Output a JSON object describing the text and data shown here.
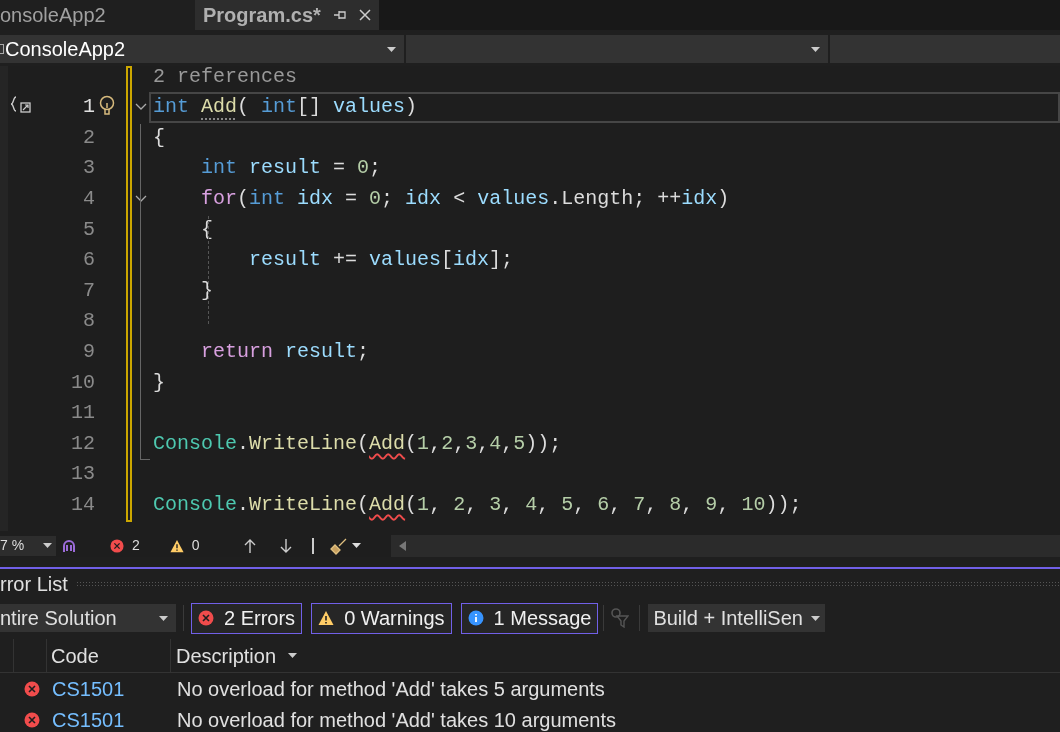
{
  "tabs": [
    {
      "label": "onsoleApp2",
      "selected": false,
      "pinned": false
    },
    {
      "label": "Program.cs*",
      "selected": true,
      "pinned": true
    }
  ],
  "nav_bar": {
    "project": "ConsoleApp2"
  },
  "editor": {
    "codelens": "2 references",
    "lines": [
      {
        "number": "1",
        "fold": true,
        "current": true,
        "tokens": [
          {
            "text": "int ",
            "color": "#569cd6",
            "kind": "plain"
          },
          {
            "text": "Add",
            "color": "#dcdcaa",
            "kind": "dotted"
          },
          {
            "text": "( ",
            "color": "#dcdcdc",
            "kind": "plain"
          },
          {
            "text": "int",
            "color": "#569cd6",
            "kind": "plain"
          },
          {
            "text": "[] ",
            "color": "#dcdcdc",
            "kind": "plain"
          },
          {
            "text": "values",
            "color": "#9cdcfe",
            "kind": "plain"
          },
          {
            "text": ")",
            "color": "#dcdcdc",
            "kind": "plain"
          }
        ]
      },
      {
        "number": "2",
        "fold": false,
        "current": false,
        "tokens": [
          {
            "text": "{",
            "color": "#dcdcdc",
            "kind": "plain"
          }
        ]
      },
      {
        "number": "3",
        "fold": false,
        "current": false,
        "tokens": [
          {
            "text": "    int ",
            "color": "#569cd6",
            "kind": "plain"
          },
          {
            "text": "result",
            "color": "#9cdcfe",
            "kind": "plain"
          },
          {
            "text": " = ",
            "color": "#dcdcdc",
            "kind": "plain"
          },
          {
            "text": "0",
            "color": "#b5cea8",
            "kind": "plain"
          },
          {
            "text": ";",
            "color": "#dcdcdc",
            "kind": "plain"
          }
        ]
      },
      {
        "number": "4",
        "fold": true,
        "current": false,
        "tokens": [
          {
            "text": "    for",
            "color": "#d8a0df",
            "kind": "plain"
          },
          {
            "text": "(",
            "color": "#dcdcdc",
            "kind": "plain"
          },
          {
            "text": "int ",
            "color": "#569cd6",
            "kind": "plain"
          },
          {
            "text": "idx",
            "color": "#9cdcfe",
            "kind": "plain"
          },
          {
            "text": " = ",
            "color": "#dcdcdc",
            "kind": "plain"
          },
          {
            "text": "0",
            "color": "#b5cea8",
            "kind": "plain"
          },
          {
            "text": "; ",
            "color": "#dcdcdc",
            "kind": "plain"
          },
          {
            "text": "idx",
            "color": "#9cdcfe",
            "kind": "plain"
          },
          {
            "text": " < ",
            "color": "#dcdcdc",
            "kind": "plain"
          },
          {
            "text": "values",
            "color": "#9cdcfe",
            "kind": "plain"
          },
          {
            "text": ".Length; ++",
            "color": "#dcdcdc",
            "kind": "plain"
          },
          {
            "text": "idx",
            "color": "#9cdcfe",
            "kind": "plain"
          },
          {
            "text": ")",
            "color": "#dcdcdc",
            "kind": "plain"
          }
        ]
      },
      {
        "number": "5",
        "fold": false,
        "current": false,
        "tokens": [
          {
            "text": "    {",
            "color": "#dcdcdc",
            "kind": "plain"
          }
        ]
      },
      {
        "number": "6",
        "fold": false,
        "current": false,
        "tokens": [
          {
            "text": "        result",
            "color": "#9cdcfe",
            "kind": "plain"
          },
          {
            "text": " += ",
            "color": "#dcdcdc",
            "kind": "plain"
          },
          {
            "text": "values",
            "color": "#9cdcfe",
            "kind": "plain"
          },
          {
            "text": "[",
            "color": "#dcdcdc",
            "kind": "plain"
          },
          {
            "text": "idx",
            "color": "#9cdcfe",
            "kind": "plain"
          },
          {
            "text": "];",
            "color": "#dcdcdc",
            "kind": "plain"
          }
        ]
      },
      {
        "number": "7",
        "fold": false,
        "current": false,
        "tokens": [
          {
            "text": "    }",
            "color": "#dcdcdc",
            "kind": "plain"
          }
        ]
      },
      {
        "number": "8",
        "fold": false,
        "current": false
      },
      {
        "number": "9",
        "fold": false,
        "current": false,
        "tokens": [
          {
            "text": "    return ",
            "color": "#d8a0df",
            "kind": "plain"
          },
          {
            "text": "result",
            "color": "#9cdcfe",
            "kind": "plain"
          },
          {
            "text": ";",
            "color": "#dcdcdc",
            "kind": "plain"
          }
        ]
      },
      {
        "number": "10",
        "fold": false,
        "current": false,
        "tokens": [
          {
            "text": "}",
            "color": "#dcdcdc",
            "kind": "plain"
          }
        ]
      },
      {
        "number": "11",
        "fold": false,
        "current": false
      },
      {
        "number": "12",
        "fold": false,
        "current": false,
        "tokens": [
          {
            "text": "Console",
            "color": "#4ec9b0",
            "kind": "plain"
          },
          {
            "text": ".",
            "color": "#dcdcdc",
            "kind": "plain"
          },
          {
            "text": "WriteLine",
            "color": "#dcdcaa",
            "kind": "plain"
          },
          {
            "text": "(",
            "color": "#dcdcdc",
            "kind": "plain"
          },
          {
            "text": "Add",
            "color": "#dcdcaa",
            "kind": "squiggle"
          },
          {
            "text": "(",
            "color": "#dcdcdc",
            "kind": "plain"
          },
          {
            "text": "1",
            "color": "#b5cea8",
            "kind": "plain"
          },
          {
            "text": ",",
            "color": "#dcdcdc",
            "kind": "plain"
          },
          {
            "text": "2",
            "color": "#b5cea8",
            "kind": "plain"
          },
          {
            "text": ",",
            "color": "#dcdcdc",
            "kind": "plain"
          },
          {
            "text": "3",
            "color": "#b5cea8",
            "kind": "plain"
          },
          {
            "text": ",",
            "color": "#dcdcdc",
            "kind": "plain"
          },
          {
            "text": "4",
            "color": "#b5cea8",
            "kind": "plain"
          },
          {
            "text": ",",
            "color": "#dcdcdc",
            "kind": "plain"
          },
          {
            "text": "5",
            "color": "#b5cea8",
            "kind": "plain"
          },
          {
            "text": "));",
            "color": "#dcdcdc",
            "kind": "plain"
          }
        ]
      },
      {
        "number": "13",
        "fold": false,
        "current": false
      },
      {
        "number": "14",
        "fold": false,
        "current": false,
        "tokens": [
          {
            "text": "Console",
            "color": "#4ec9b0",
            "kind": "plain"
          },
          {
            "text": ".",
            "color": "#dcdcdc",
            "kind": "plain"
          },
          {
            "text": "WriteLine",
            "color": "#dcdcaa",
            "kind": "plain"
          },
          {
            "text": "(",
            "color": "#dcdcdc",
            "kind": "plain"
          },
          {
            "text": "Add",
            "color": "#dcdcaa",
            "kind": "squiggle"
          },
          {
            "text": "(",
            "color": "#dcdcdc",
            "kind": "plain"
          },
          {
            "text": "1",
            "color": "#b5cea8",
            "kind": "plain"
          },
          {
            "text": ", ",
            "color": "#dcdcdc",
            "kind": "plain"
          },
          {
            "text": "2",
            "color": "#b5cea8",
            "kind": "plain"
          },
          {
            "text": ", ",
            "color": "#dcdcdc",
            "kind": "plain"
          },
          {
            "text": "3",
            "color": "#b5cea8",
            "kind": "plain"
          },
          {
            "text": ", ",
            "color": "#dcdcdc",
            "kind": "plain"
          },
          {
            "text": "4",
            "color": "#b5cea8",
            "kind": "plain"
          },
          {
            "text": ", ",
            "color": "#dcdcdc",
            "kind": "plain"
          },
          {
            "text": "5",
            "color": "#b5cea8",
            "kind": "plain"
          },
          {
            "text": ", ",
            "color": "#dcdcdc",
            "kind": "plain"
          },
          {
            "text": "6",
            "color": "#b5cea8",
            "kind": "plain"
          },
          {
            "text": ", ",
            "color": "#dcdcdc",
            "kind": "plain"
          },
          {
            "text": "7",
            "color": "#b5cea8",
            "kind": "plain"
          },
          {
            "text": ", ",
            "color": "#dcdcdc",
            "kind": "plain"
          },
          {
            "text": "8",
            "color": "#b5cea8",
            "kind": "plain"
          },
          {
            "text": ", ",
            "color": "#dcdcdc",
            "kind": "plain"
          },
          {
            "text": "9",
            "color": "#b5cea8",
            "kind": "plain"
          },
          {
            "text": ", ",
            "color": "#dcdcdc",
            "kind": "plain"
          },
          {
            "text": "10",
            "color": "#b5cea8",
            "kind": "plain"
          },
          {
            "text": "));",
            "color": "#dcdcdc",
            "kind": "plain"
          }
        ]
      }
    ]
  },
  "status_bar": {
    "zoom": "7 %",
    "errors": "2",
    "warnings": "0"
  },
  "error_list": {
    "title": "rror List",
    "scope": "ntire Solution",
    "filters": [
      {
        "kind": "error",
        "label": "2 Errors",
        "selected": true
      },
      {
        "kind": "warning",
        "label": "0 Warnings",
        "selected": true
      },
      {
        "kind": "info",
        "label": "1 Message",
        "selected": true
      }
    ],
    "source": "Build + IntelliSen",
    "columns": [
      "Code",
      "Description"
    ],
    "rows": [
      {
        "kind": "error",
        "code": "CS1501",
        "description": "No overload for method 'Add' takes 5 arguments"
      },
      {
        "kind": "error",
        "code": "CS1501",
        "description": "No overload for method 'Add' takes 10 arguments"
      }
    ]
  }
}
